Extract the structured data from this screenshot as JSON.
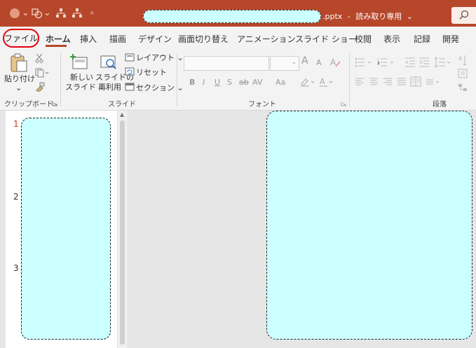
{
  "titlebar": {
    "filename_suffix": ".pptx",
    "separator": "-",
    "mode": "読み取り専用",
    "mode_caret": "⌄"
  },
  "tabs": {
    "file": "ファイル",
    "home": "ホーム",
    "insert": "挿入",
    "draw": "描画",
    "design": "デザイン",
    "transitions": "画面切り替え",
    "animations": "アニメーション",
    "slideshow": "スライド ショー",
    "review": "校閲",
    "view": "表示",
    "record": "記録",
    "developer": "開発"
  },
  "ribbon": {
    "clipboard": {
      "paste": "貼り付け",
      "paste_caret": "⌄",
      "label": "クリップボード"
    },
    "slides": {
      "new_slide_line1": "新しい",
      "new_slide_line2": "スライド ⌄",
      "reuse_line1": "スライドの",
      "reuse_line2": "再利用",
      "layout": "レイアウト ⌄",
      "reset": "リセット",
      "section": "セクション ⌄",
      "label": "スライド"
    },
    "font": {
      "grow": "A",
      "shrink": "A",
      "bold": "B",
      "italic": "I",
      "underline": "U",
      "shadow": "S",
      "strike": "ab",
      "spacing": "AV",
      "case": "Aa",
      "label": "フォント"
    },
    "paragraph": {
      "label": "段落"
    }
  },
  "thumbnails": {
    "numbers": [
      "1",
      "2",
      "3"
    ]
  },
  "colors": {
    "accent": "#b7472a",
    "mask": "#ccffff",
    "highlight": "#e8000b"
  }
}
